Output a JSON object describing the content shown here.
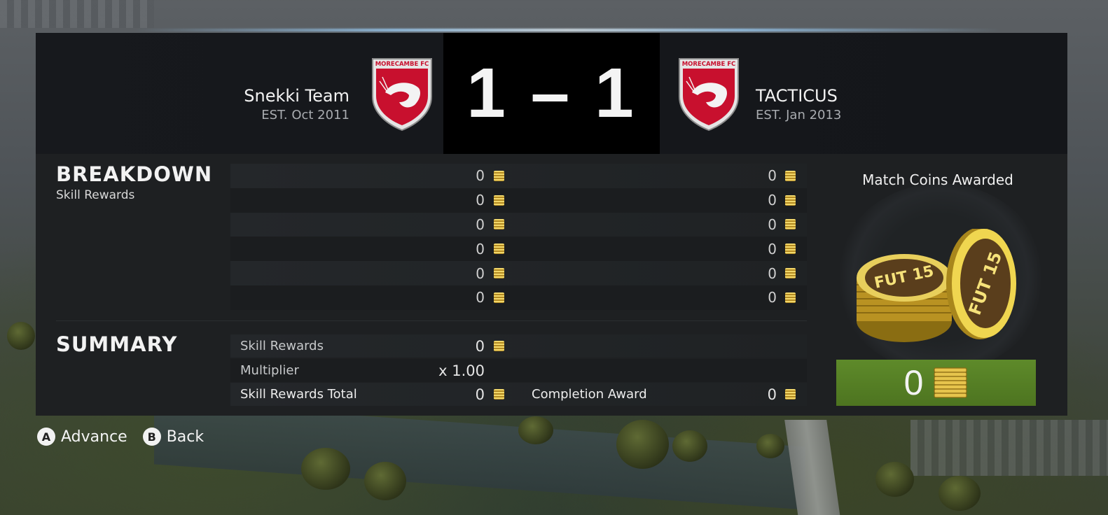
{
  "match": {
    "home": {
      "name": "Snekki Team",
      "est": "EST. Oct 2011",
      "club": "MORECAMBE FC"
    },
    "away": {
      "name": "TACTICUS",
      "est": "EST. Jan 2013",
      "club": "MORECAMBE FC"
    },
    "score": "1 – 1"
  },
  "breakdown": {
    "title": "BREAKDOWN",
    "subtitle": "Skill Rewards",
    "rows": [
      {
        "left": "0",
        "right": "0"
      },
      {
        "left": "0",
        "right": "0"
      },
      {
        "left": "0",
        "right": "0"
      },
      {
        "left": "0",
        "right": "0"
      },
      {
        "left": "0",
        "right": "0"
      },
      {
        "left": "0",
        "right": "0"
      }
    ]
  },
  "summary": {
    "title": "SUMMARY",
    "skill_rewards_label": "Skill Rewards",
    "skill_rewards_value": "0",
    "multiplier_label": "Multiplier",
    "multiplier_value": "x 1.00",
    "skill_total_label": "Skill Rewards Total",
    "skill_total_value": "0",
    "completion_label": "Completion Award",
    "completion_value": "0"
  },
  "award": {
    "title": "Match Coins Awarded",
    "coin_text": "FUT 15",
    "total": "0",
    "box_color": "#5e8a2a"
  },
  "controls": [
    {
      "glyph": "A",
      "label": "Advance"
    },
    {
      "glyph": "B",
      "label": "Back"
    }
  ]
}
